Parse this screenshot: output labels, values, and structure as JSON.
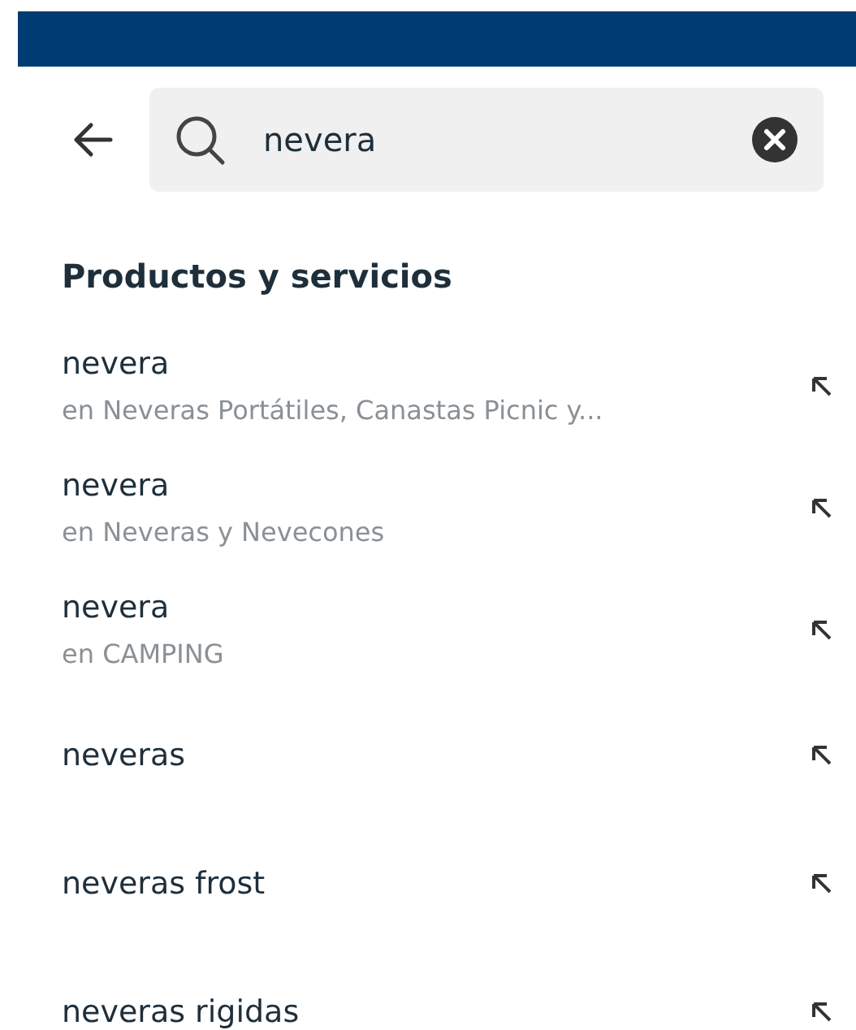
{
  "search": {
    "value": "nevera"
  },
  "section": {
    "title": "Productos y servicios"
  },
  "suggestions": [
    {
      "text": "nevera",
      "category": "en Neveras Portátiles, Canastas Picnic y..."
    },
    {
      "text": "nevera",
      "category": "en Neveras y Nevecones"
    },
    {
      "text": "nevera",
      "category": "en CAMPING"
    },
    {
      "text": "neveras"
    },
    {
      "text": "neveras frost"
    },
    {
      "text": "neveras rigidas"
    }
  ]
}
